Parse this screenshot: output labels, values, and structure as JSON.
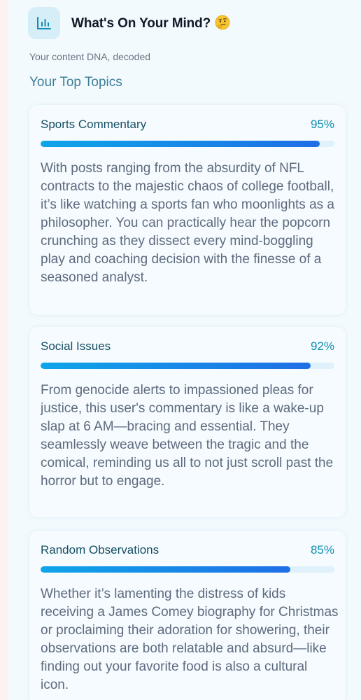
{
  "header": {
    "title": "What's On Your Mind?",
    "emoji_icon": "thinking-face-icon",
    "chart_icon": "bar-chart-icon",
    "subtitle": "Your content DNA, decoded"
  },
  "section_title": "Your Top Topics",
  "colors": {
    "accent": "#0e8fb3",
    "bar_start": "#0ea5e9",
    "bar_end": "#1f6fe6",
    "track": "#dff1fa"
  },
  "topics": [
    {
      "name": "Sports Commentary",
      "percent_label": "95%",
      "percent": 95,
      "description": "With posts ranging from the absurdity of NFL contracts to the majestic chaos of college football, it’s like watching a sports fan who moonlights as a philosopher. You can practically hear the popcorn crunching as they dissect every mind-boggling play and coaching decision with the finesse of a seasoned analyst."
    },
    {
      "name": "Social Issues",
      "percent_label": "92%",
      "percent": 92,
      "description": "From genocide alerts to impassioned pleas for justice, this user's commentary is like a wake-up slap at 6 AM—bracing and essential. They seamlessly weave between the tragic and the comical, reminding us all to not just scroll past the horror but to engage."
    },
    {
      "name": "Random Observations",
      "percent_label": "85%",
      "percent": 85,
      "description": "Whether it’s lamenting the distress of kids receiving a James Comey biography for Christmas or proclaiming their adoration for showering, their observations are both relatable and absurd—like finding out your favorite food is also a cultural icon."
    }
  ]
}
